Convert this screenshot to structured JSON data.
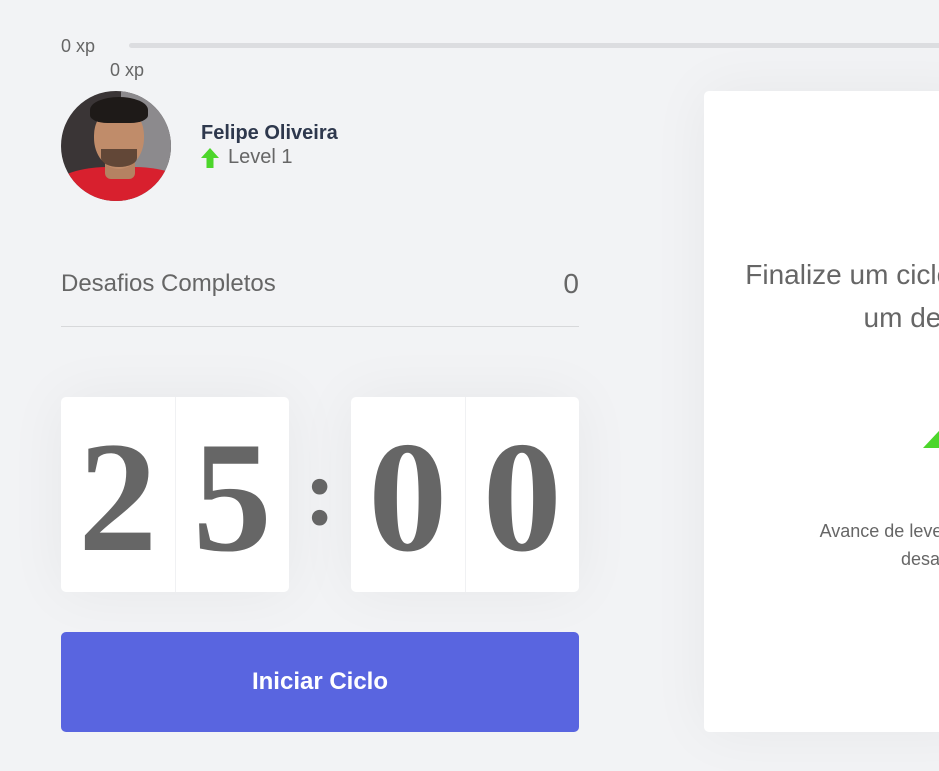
{
  "xp_bar": {
    "start_label": "0 xp",
    "current_label": "0 xp",
    "progress": 0
  },
  "profile": {
    "name": "Felipe Oliveira",
    "level": "Level 1",
    "level_icon": "level-up-arrow-icon",
    "level_icon_color": "#4cd62b"
  },
  "challenges": {
    "label": "Desafios Completos",
    "count": "0"
  },
  "countdown": {
    "minute_tens": "2",
    "minute_ones": "5",
    "separator": ":",
    "second_tens": "0",
    "second_ones": "0"
  },
  "start_button": {
    "label": "Iniciar Ciclo",
    "color": "#5965e0"
  },
  "challenge_panel": {
    "title_line1": "Finalize um ciclo para receber",
    "title_line2": "um desafio",
    "icon": "level-up-icon",
    "desc_line1": "Avance de level completando",
    "desc_line2": "desafios."
  }
}
